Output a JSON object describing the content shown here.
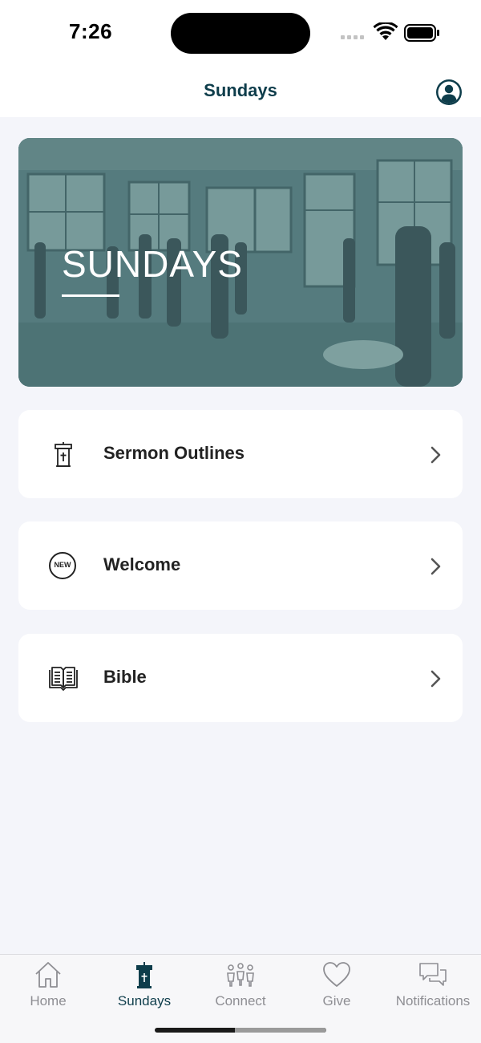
{
  "status_bar": {
    "time": "7:26"
  },
  "header": {
    "title": "Sundays",
    "profile_icon": "person-circle-icon"
  },
  "hero": {
    "title": "SUNDAYS"
  },
  "menu": [
    {
      "label": "Sermon Outlines",
      "icon": "pulpit-icon"
    },
    {
      "label": "Welcome",
      "icon": "new-badge-icon",
      "badge_text": "NEW"
    },
    {
      "label": "Bible",
      "icon": "open-book-icon"
    }
  ],
  "tabs": [
    {
      "label": "Home",
      "icon": "home-icon",
      "active": false
    },
    {
      "label": "Sundays",
      "icon": "pulpit-icon",
      "active": true
    },
    {
      "label": "Connect",
      "icon": "people-icon",
      "active": false
    },
    {
      "label": "Give",
      "icon": "heart-icon",
      "active": false
    },
    {
      "label": "Notifications",
      "icon": "chat-bubbles-icon",
      "active": false
    }
  ],
  "colors": {
    "brand": "#0e3d4b",
    "inactive_tab": "#8e8e93",
    "background": "#f4f5fa",
    "hero_overlay": "#577d80"
  }
}
